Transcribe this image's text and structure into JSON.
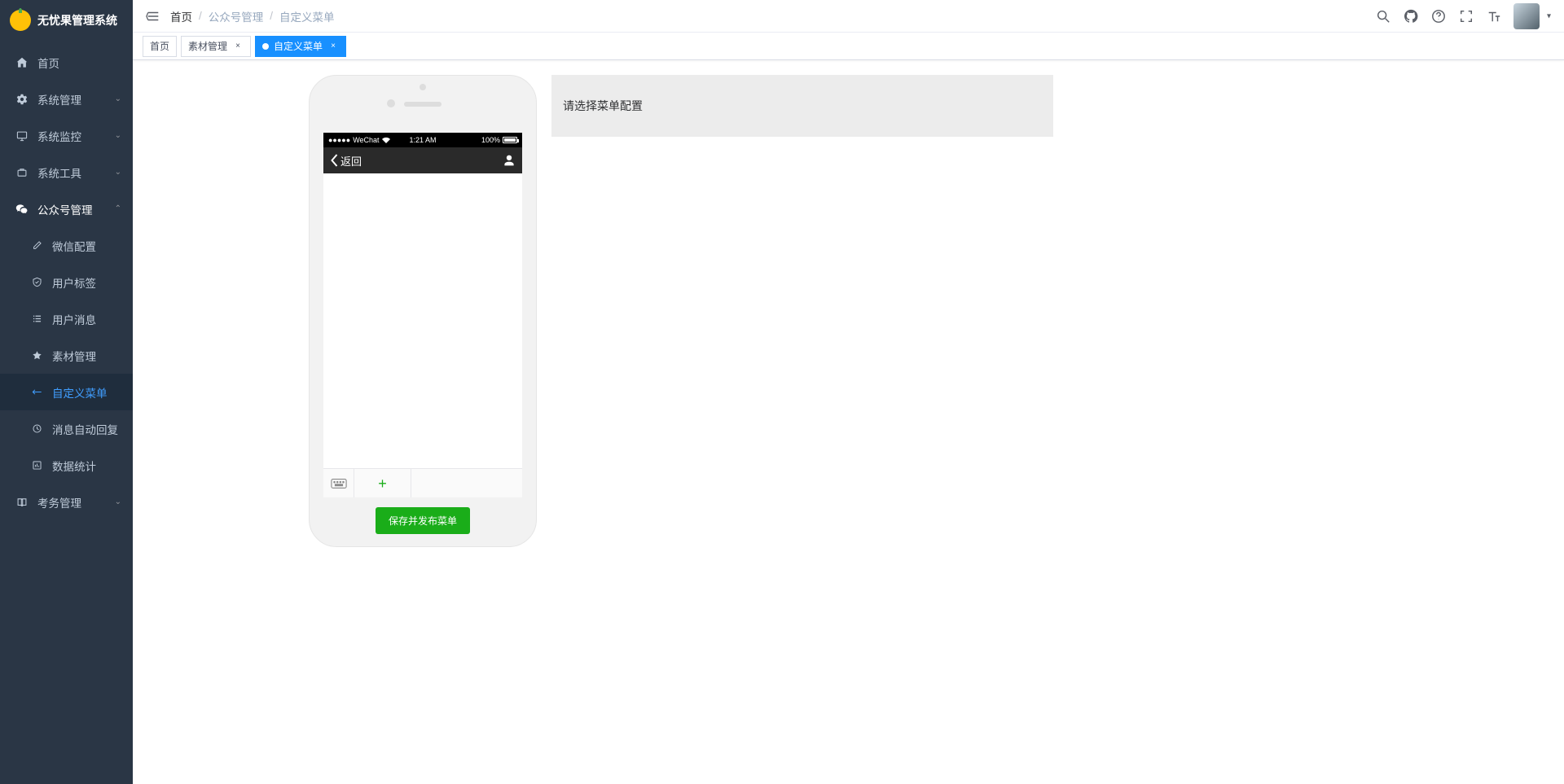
{
  "app": {
    "title": "无忧果管理系统"
  },
  "sidebar": {
    "items": [
      {
        "icon": "dashboard",
        "label": "首页"
      },
      {
        "icon": "gear",
        "label": "系统管理",
        "expandable": true
      },
      {
        "icon": "monitor",
        "label": "系统监控",
        "expandable": true
      },
      {
        "icon": "tool",
        "label": "系统工具",
        "expandable": true
      },
      {
        "icon": "wechat",
        "label": "公众号管理",
        "expandable": true,
        "expanded": true
      },
      {
        "icon": "book",
        "label": "考务管理",
        "expandable": true
      }
    ],
    "submenu": [
      {
        "icon": "edit",
        "label": "微信配置"
      },
      {
        "icon": "shield",
        "label": "用户标签"
      },
      {
        "icon": "list",
        "label": "用户消息"
      },
      {
        "icon": "star",
        "label": "素材管理"
      },
      {
        "icon": "plus",
        "label": "自定义菜单",
        "active": true
      },
      {
        "icon": "dash",
        "label": "消息自动回复"
      },
      {
        "icon": "data",
        "label": "数据统计"
      }
    ]
  },
  "breadcrumb": {
    "items": [
      "首页",
      "公众号管理",
      "自定义菜单"
    ]
  },
  "tabs": [
    {
      "label": "首页",
      "closable": false
    },
    {
      "label": "素材管理",
      "closable": true
    },
    {
      "label": "自定义菜单",
      "closable": true,
      "active": true
    }
  ],
  "phone": {
    "carrier": "WeChat",
    "time": "1:21 AM",
    "battery": "100%",
    "back": "返回",
    "publish": "保存并发布菜单"
  },
  "config": {
    "hint": "请选择菜单配置"
  }
}
